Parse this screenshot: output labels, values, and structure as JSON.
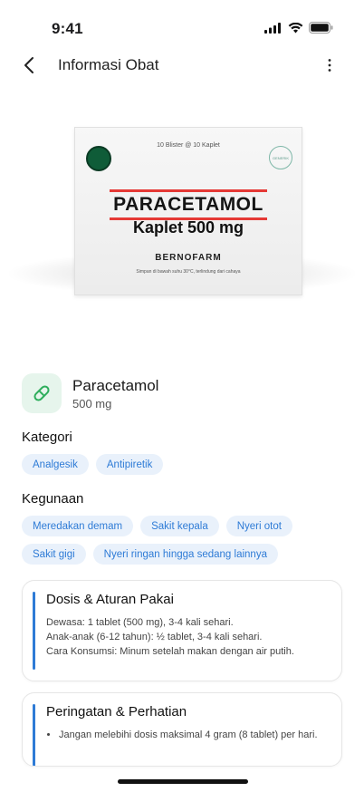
{
  "status": {
    "time": "9:41"
  },
  "appbar": {
    "title": "Informasi Obat"
  },
  "hero": {
    "box_top_text": "10 Blister @ 10 Kaplet",
    "badge_text": "GENERIK",
    "product_name": "PARACETAMOL",
    "product_sub": "Kaplet 500 mg",
    "brand": "BERNOFARM",
    "storage": "Simpan di bawah suhu 30°C, terlindung dari cahaya",
    "accent_color": "#e53935",
    "dot_color": "#0f5c38"
  },
  "drug": {
    "name": "Paracetamol",
    "dose": "500 mg"
  },
  "kategori": {
    "label": "Kategori",
    "items": [
      "Analgesik",
      "Antipiretik"
    ]
  },
  "kegunaan": {
    "label": "Kegunaan",
    "items": [
      "Meredakan demam",
      "Sakit kepala",
      "Nyeri otot",
      "Sakit gigi",
      "Nyeri ringan hingga sedang lainnya"
    ]
  },
  "dosis": {
    "title": "Dosis & Aturan Pakai",
    "lines": [
      "Dewasa: 1 tablet (500 mg), 3-4 kali sehari.",
      "Anak-anak (6-12 tahun): ½ tablet, 3-4 kali sehari.",
      "Cara Konsumsi: Minum setelah makan dengan air putih."
    ]
  },
  "peringatan": {
    "title": "Peringatan & Perhatian",
    "items": [
      "Jangan melebihi dosis maksimal 4 gram (8 tablet) per hari."
    ]
  },
  "colors": {
    "chip_bg": "#e9f1fb",
    "chip_text": "#2e7bd6",
    "accent_bar": "#2e7bd6",
    "icon_bg": "#e6f5ec",
    "icon": "#2eae5c"
  }
}
